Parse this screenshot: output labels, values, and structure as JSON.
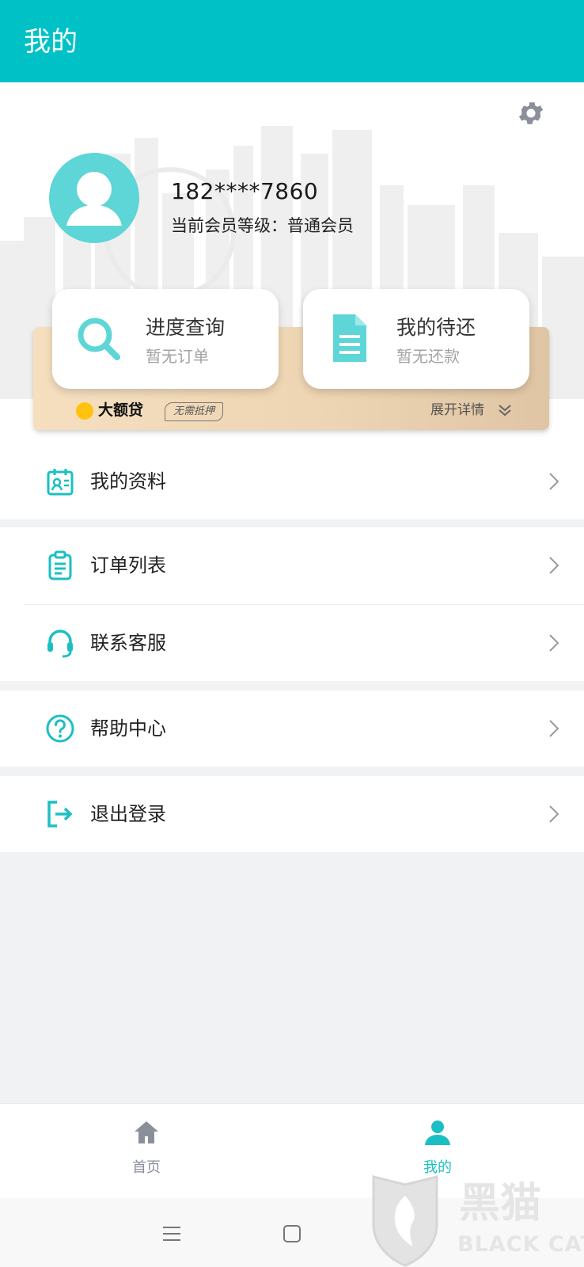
{
  "header": {
    "title": "我的"
  },
  "profile": {
    "phone": "182****7860",
    "member_level": "当前会员等级：普通会员"
  },
  "cards": [
    {
      "title": "进度查询",
      "subtitle": "暂无订单",
      "icon": "search-icon"
    },
    {
      "title": "我的待还",
      "subtitle": "暂无还款",
      "icon": "document-icon"
    }
  ],
  "brand": {
    "name": "大额贷",
    "tag": "无需抵押",
    "expand_label": "展开详情"
  },
  "menu": [
    {
      "label": "我的资料",
      "icon": "profile-card-icon"
    },
    {
      "label": "订单列表",
      "icon": "clipboard-icon"
    },
    {
      "label": "联系客服",
      "icon": "headset-icon"
    },
    {
      "label": "帮助中心",
      "icon": "question-circle-icon"
    },
    {
      "label": "退出登录",
      "icon": "logout-icon"
    }
  ],
  "tabbar": {
    "items": [
      {
        "label": "首页",
        "icon": "home-icon",
        "active": false
      },
      {
        "label": "我的",
        "icon": "user-icon",
        "active": true
      }
    ]
  },
  "watermark": {
    "text": "黑猫",
    "subtext": "BLACK CAT"
  },
  "colors": {
    "accent": "#00c2c6",
    "icon_teal": "#1bbfc3",
    "gold": "#eed5b3",
    "inactive": "#8a8f99"
  }
}
